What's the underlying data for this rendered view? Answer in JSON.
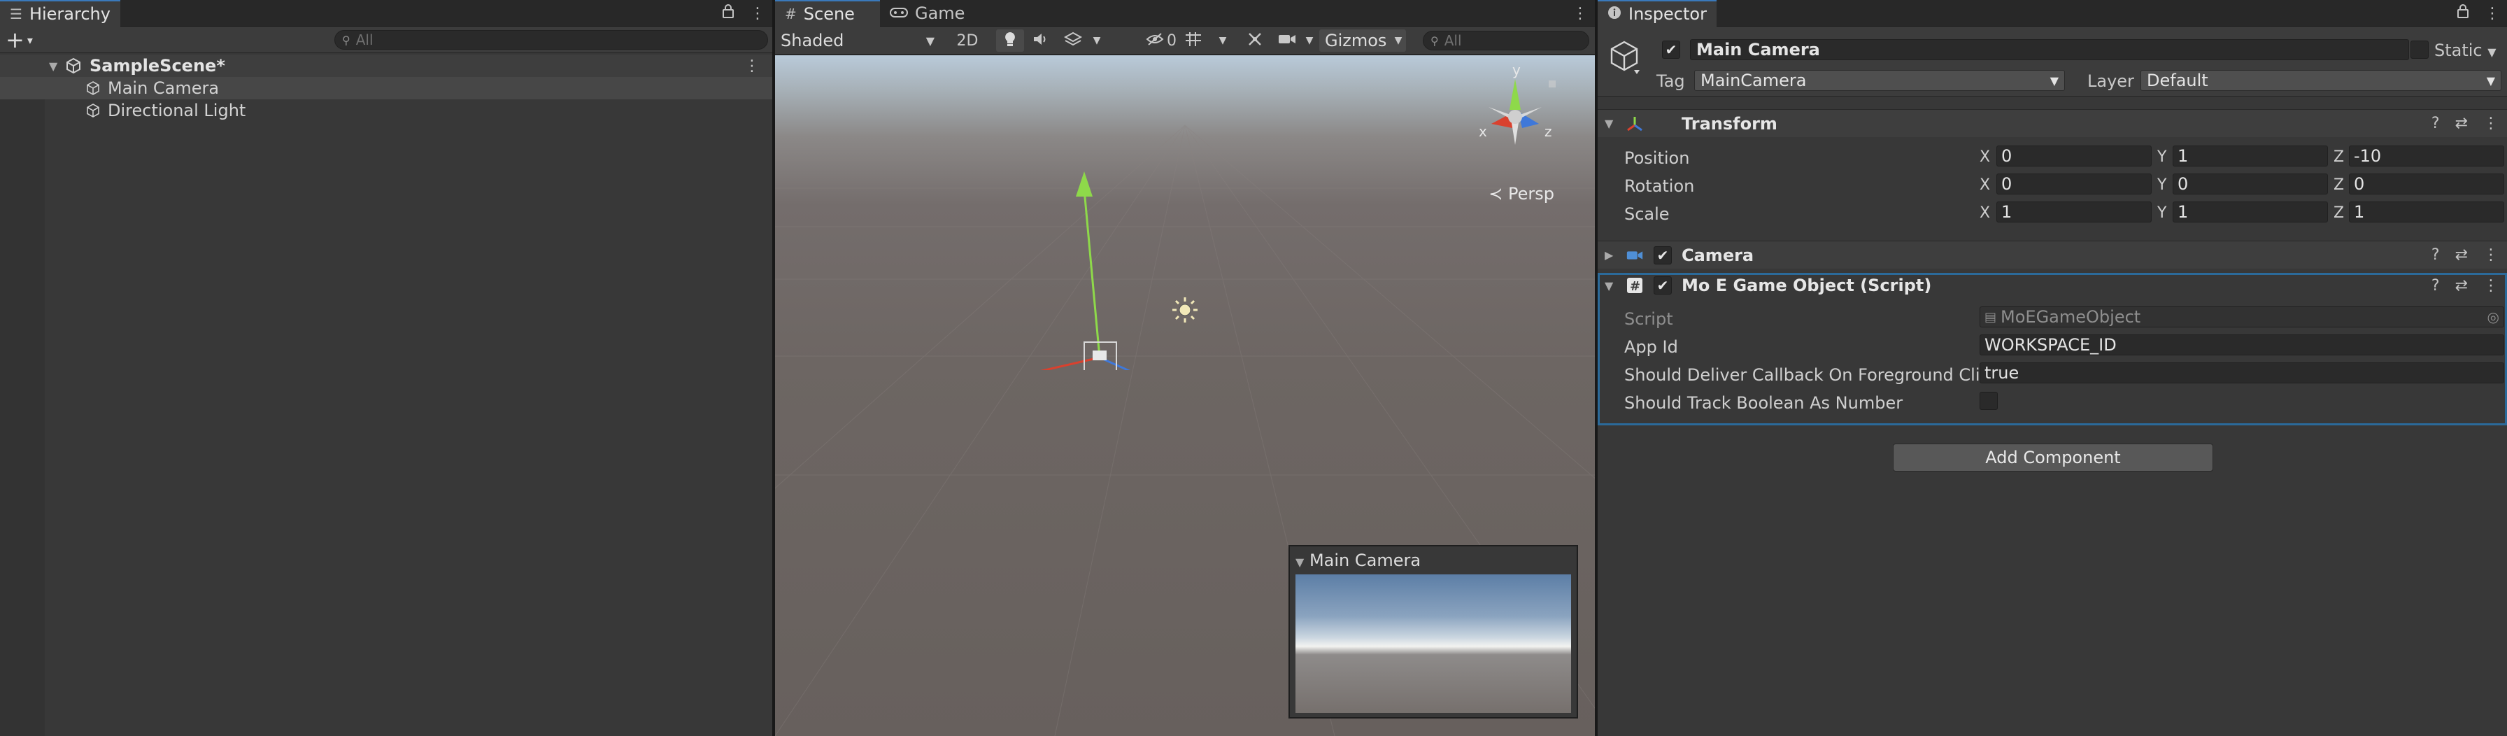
{
  "hierarchy": {
    "tab_label": "Hierarchy",
    "search_placeholder": "All",
    "scene_name": "SampleScene*",
    "items": [
      {
        "label": "Main Camera",
        "selected": true
      },
      {
        "label": "Directional Light",
        "selected": false
      }
    ]
  },
  "scene": {
    "tabs": [
      {
        "label": "Scene",
        "active": true
      },
      {
        "label": "Game",
        "active": false
      }
    ],
    "shading_mode": "Shaded",
    "mode_2d": "2D",
    "hidden_count": "0",
    "gizmos_label": "Gizmos",
    "search_placeholder": "All",
    "gizmo_axes": {
      "x": "x",
      "y": "y",
      "z": "z"
    },
    "projection_label": "Persp",
    "camera_preview_title": "Main Camera"
  },
  "inspector": {
    "tab_label": "Inspector",
    "object_name": "Main Camera",
    "active": true,
    "static_label": "Static",
    "tag_label": "Tag",
    "tag_value": "MainCamera",
    "layer_label": "Layer",
    "layer_value": "Default",
    "transform": {
      "title": "Transform",
      "rows": [
        {
          "label": "Position",
          "x": "0",
          "y": "1",
          "z": "-10"
        },
        {
          "label": "Rotation",
          "x": "0",
          "y": "0",
          "z": "0"
        },
        {
          "label": "Scale",
          "x": "1",
          "y": "1",
          "z": "1"
        }
      ],
      "axis_x": "X",
      "axis_y": "Y",
      "axis_z": "Z"
    },
    "camera": {
      "title": "Camera",
      "enabled": true
    },
    "script_component": {
      "title": "Mo E Game Object (Script)",
      "enabled": true,
      "script_label": "Script",
      "script_value": "MoEGameObject",
      "app_id_label": "App Id",
      "app_id_value": "WORKSPACE_ID",
      "deliver_label": "Should Deliver Callback On Foreground Click",
      "deliver_value": "true",
      "track_bool_label": "Should Track Boolean As Number",
      "track_bool_checked": false
    },
    "add_component_label": "Add Component"
  },
  "colors": {
    "accent_blue": "#3a79bb",
    "selection_outline": "#2b6a9a",
    "axis_x": "#d9412e",
    "axis_y": "#8ed94a",
    "axis_z": "#3f78d9"
  }
}
